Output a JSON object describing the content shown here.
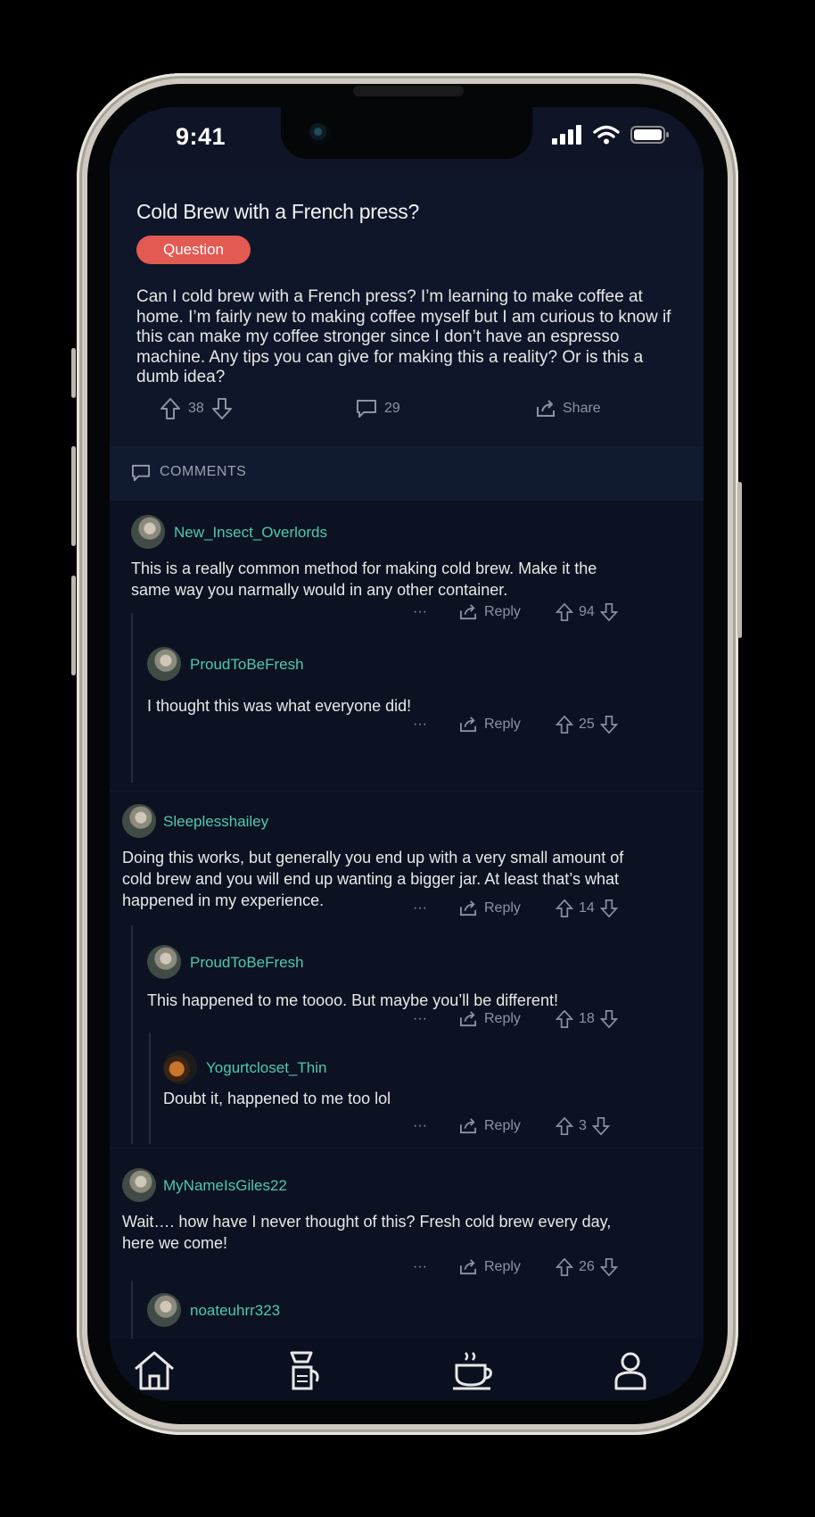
{
  "status_bar": {
    "time": "9:41"
  },
  "post": {
    "title": "Cold Brew with a French press?",
    "tag": "Question",
    "body": "Can I cold brew with a French press? I’m learning to make coffee at home. I’m fairly new to making coffee myself but I am curious to know if this can make my coffee stronger since I don’t have an espresso machine. Any tips you can give for making this a reality? Or is this a dumb idea?",
    "votes": "38",
    "comments_count": "29",
    "share_label": "Share"
  },
  "comments_header": "COMMENTS",
  "reply_label": "Reply",
  "more_label": "···",
  "comments": [
    {
      "user": "New_Insect_Overlords",
      "text": "This is a really common method for making cold brew. Make it the same way you narmally would in any other container.",
      "votes": "94"
    },
    {
      "user": "ProudToBeFresh",
      "text": "I thought this was what everyone did!",
      "votes": "25"
    },
    {
      "user": "Sleeplesshailey",
      "text": "Doing this works, but generally you end up with a very small amount of cold brew and you will end up wanting a bigger jar. At least that’s what happened in my experience.",
      "votes": "14"
    },
    {
      "user": "ProudToBeFresh",
      "text": "This happened to me toooo. But maybe you’ll be different!",
      "votes": "18"
    },
    {
      "user": "Yogurtcloset_Thin",
      "text": "Doubt it, happened to me too lol",
      "votes": "3"
    },
    {
      "user": "MyNameIsGiles22",
      "text": "Wait…. how have I never thought of this? Fresh cold brew every day, here we come!",
      "votes": "26"
    },
    {
      "user": "noateuhrr323"
    }
  ],
  "tabbar": [
    "home-icon",
    "coffee-maker-icon",
    "coffee-cup-icon",
    "profile-icon"
  ],
  "colors": {
    "accent": "#4ec9b0",
    "tag": "#e35a52",
    "background": "#0d1222"
  }
}
